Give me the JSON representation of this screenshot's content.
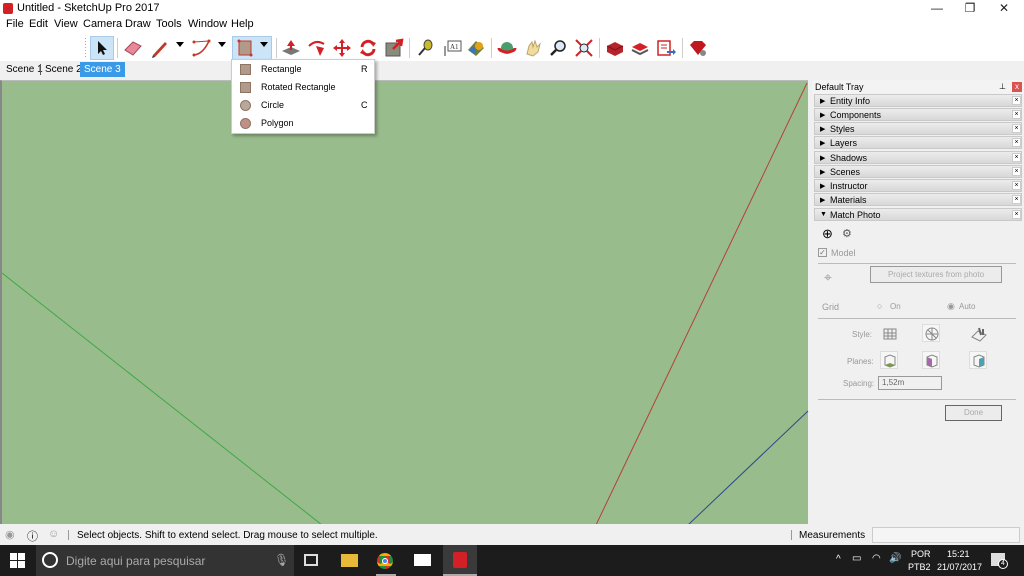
{
  "window": {
    "title": "Untitled - SketchUp Pro 2017",
    "controls": {
      "minimize": "—",
      "restore": "❐",
      "close": "✕"
    }
  },
  "menubar": [
    "File",
    "Edit",
    "View",
    "Camera",
    "Draw",
    "Tools",
    "Window",
    "Help"
  ],
  "toolbar": {
    "tools": [
      {
        "name": "select",
        "icon": "arrow-icon",
        "active": true
      },
      {
        "name": "eraser",
        "icon": "eraser-icon"
      },
      {
        "name": "line",
        "icon": "pencil-icon",
        "has_menu": true
      },
      {
        "name": "arc",
        "icon": "arc-icon",
        "has_menu": true
      },
      {
        "name": "rectangle",
        "icon": "rectangle-icon",
        "has_menu": true,
        "active": true
      },
      {
        "name": "push-pull",
        "icon": "push-pull-icon"
      },
      {
        "name": "follow-me",
        "icon": "follow-me-icon"
      },
      {
        "name": "move",
        "icon": "move-icon"
      },
      {
        "name": "rotate",
        "icon": "rotate-icon"
      },
      {
        "name": "scale",
        "icon": "scale-icon"
      },
      {
        "name": "tape-measure",
        "icon": "tape-measure-icon"
      },
      {
        "name": "text",
        "icon": "text-icon"
      },
      {
        "name": "paint-bucket",
        "icon": "paint-bucket-icon"
      },
      {
        "name": "orbit",
        "icon": "orbit-icon"
      },
      {
        "name": "pan",
        "icon": "pan-icon"
      },
      {
        "name": "zoom",
        "icon": "zoom-icon"
      },
      {
        "name": "zoom-extents",
        "icon": "zoom-extents-icon"
      },
      {
        "name": "3d-warehouse",
        "icon": "warehouse-icon"
      },
      {
        "name": "extension-warehouse",
        "icon": "extension-warehouse-icon"
      },
      {
        "name": "layout",
        "icon": "send-to-layout-icon"
      },
      {
        "name": "extension-manager",
        "icon": "ruby-icon"
      }
    ],
    "text_icon_label": "A1"
  },
  "scenes": [
    {
      "label": "Scene 1",
      "active": false
    },
    {
      "label": "Scene 2",
      "active": false
    },
    {
      "label": "Scene 3",
      "active": true
    }
  ],
  "shape_menu": [
    {
      "label": "Rectangle",
      "shortcut": "R",
      "icon": "rectangle-icon"
    },
    {
      "label": "Rotated Rectangle",
      "shortcut": "",
      "icon": "rotated-rectangle-icon"
    },
    {
      "label": "Circle",
      "shortcut": "C",
      "icon": "circle-icon"
    },
    {
      "label": "Polygon",
      "shortcut": "",
      "icon": "polygon-icon"
    }
  ],
  "viewport": {
    "background": "#99bc8c",
    "axes": {
      "red": "#b4413a",
      "green": "#3fa845",
      "blue": "#2c4a8a"
    }
  },
  "tray": {
    "title": "Default Tray",
    "pin": "⊥",
    "close": "x",
    "panels": [
      {
        "label": "Entity Info",
        "expanded": false
      },
      {
        "label": "Components",
        "expanded": false
      },
      {
        "label": "Styles",
        "expanded": false
      },
      {
        "label": "Layers",
        "expanded": false
      },
      {
        "label": "Shadows",
        "expanded": false
      },
      {
        "label": "Scenes",
        "expanded": false
      },
      {
        "label": "Instructor",
        "expanded": false
      },
      {
        "label": "Materials",
        "expanded": false
      },
      {
        "label": "Match Photo",
        "expanded": true
      }
    ],
    "match_photo": {
      "model_checkbox": "Model",
      "model_checked": true,
      "project_button": "Project textures from photo",
      "grid_label": "Grid",
      "grid_on": "On",
      "grid_auto": "Auto",
      "grid_selected": "Auto",
      "style_label": "Style:",
      "planes_label": "Planes:",
      "spacing_label": "Spacing:",
      "spacing_value": "1,52m",
      "done_button": "Done"
    }
  },
  "statusbar": {
    "message": "Select objects. Shift to extend select. Drag mouse to select multiple.",
    "measurements_label": "Measurements",
    "measurements_value": ""
  },
  "taskbar": {
    "search_placeholder": "Digite aqui para pesquisar",
    "lang_top": "POR",
    "lang_bottom": "PTB2",
    "time": "15:21",
    "date": "21/07/2017",
    "notifications": "4",
    "apps": [
      "task-view",
      "file-explorer",
      "chrome",
      "mail",
      "sketchup"
    ]
  }
}
